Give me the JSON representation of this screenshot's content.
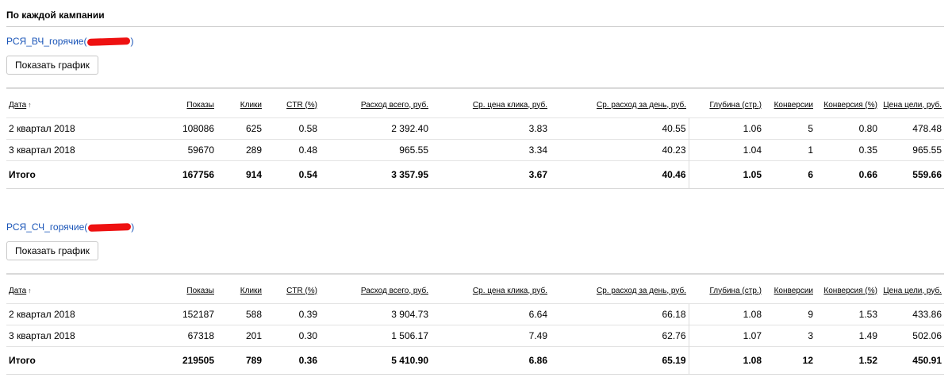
{
  "section_title": "По каждой кампании",
  "table_headers": [
    "Дата",
    "Показы",
    "Клики",
    "CTR (%)",
    "Расход всего, руб.",
    "Ср. цена клика, руб.",
    "Ср. расход за день, руб.",
    "Глубина (стр.)",
    "Конверсии",
    "Конверсия (%)",
    "Цена цели, руб."
  ],
  "sort_indicator": "↑",
  "campaigns": [
    {
      "name": "РСЯ_ВЧ_горячие",
      "paren_open": "(",
      "paren_close": ")",
      "show_chart_label": "Показать график",
      "rows": [
        [
          "2 квартал 2018",
          "108086",
          "625",
          "0.58",
          "2 392.40",
          "3.83",
          "40.55",
          "1.06",
          "5",
          "0.80",
          "478.48"
        ],
        [
          "3 квартал 2018",
          "59670",
          "289",
          "0.48",
          "965.55",
          "3.34",
          "40.23",
          "1.04",
          "1",
          "0.35",
          "965.55"
        ]
      ],
      "total": [
        "Итого",
        "167756",
        "914",
        "0.54",
        "3 357.95",
        "3.67",
        "40.46",
        "1.05",
        "6",
        "0.66",
        "559.66"
      ]
    },
    {
      "name": "РСЯ_СЧ_горячие",
      "paren_open": "(",
      "paren_close": ")",
      "show_chart_label": "Показать график",
      "rows": [
        [
          "2 квартал 2018",
          "152187",
          "588",
          "0.39",
          "3 904.73",
          "6.64",
          "66.18",
          "1.08",
          "9",
          "1.53",
          "433.86"
        ],
        [
          "3 квартал 2018",
          "67318",
          "201",
          "0.30",
          "1 506.17",
          "7.49",
          "62.76",
          "1.07",
          "3",
          "1.49",
          "502.06"
        ]
      ],
      "total": [
        "Итого",
        "219505",
        "789",
        "0.36",
        "5 410.90",
        "6.86",
        "65.19",
        "1.08",
        "12",
        "1.52",
        "450.91"
      ]
    }
  ],
  "colors": {
    "link": "#1a55b8",
    "redaction": "#ee1111",
    "rule": "#d9d9d9"
  }
}
